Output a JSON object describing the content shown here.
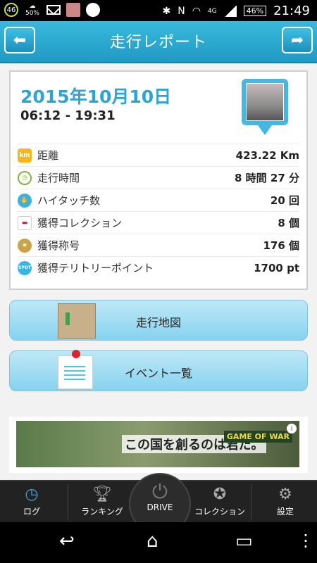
{
  "status_bar": {
    "badge_number": "46",
    "weather_percent": "50%",
    "network": "4G",
    "battery": "46%",
    "time": "21:49"
  },
  "header": {
    "title": "走行レポート"
  },
  "report": {
    "date": "2015年10月10日",
    "time_range": "06:12 - 19:31",
    "stats": [
      {
        "icon": "km-icon",
        "icon_text": "km",
        "label": "距離",
        "value": "423.22 Km"
      },
      {
        "icon": "clock-icon",
        "icon_text": "",
        "label": "走行時間",
        "value": "8 時間 27 分"
      },
      {
        "icon": "hand-icon",
        "icon_text": "",
        "label": "ハイタッチ数",
        "value": "20 回"
      },
      {
        "icon": "car-icon",
        "icon_text": "",
        "label": "獲得コレクション",
        "value": "8 個"
      },
      {
        "icon": "medal-icon",
        "icon_text": "",
        "label": "獲得称号",
        "value": "176 個"
      },
      {
        "icon": "spot-icon",
        "icon_text": "SPOT",
        "label": "獲得テリトリーポイント",
        "value": "1700 pt"
      }
    ]
  },
  "actions": {
    "map_label": "走行地図",
    "event_label": "イベント一覧"
  },
  "ad": {
    "text": "この国を創るのは君だ。",
    "brand": "GAME OF WAR",
    "info": "i"
  },
  "tabs": [
    {
      "label": "ログ"
    },
    {
      "label": "ランキング"
    },
    {
      "label": "DRIVE"
    },
    {
      "label": "コレクション"
    },
    {
      "label": "設定"
    }
  ]
}
